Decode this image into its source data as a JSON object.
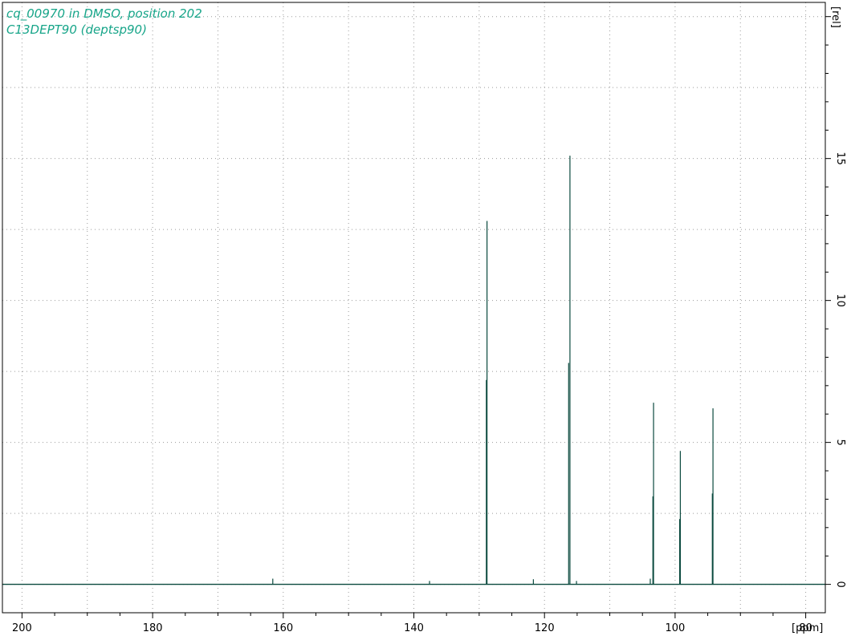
{
  "header": {
    "line1": "cq_00970 in DMSO, position 202",
    "line2": "C13DEPT90 (deptsp90)"
  },
  "chart_data": {
    "type": "line",
    "title": "",
    "xlabel": "[ppm]",
    "ylabel": "[rel]",
    "x_reversed": true,
    "xlim": [
      203.0,
      77.0
    ],
    "ylim": [
      -1.0,
      20.5
    ],
    "x_ticks": [
      200,
      180,
      160,
      140,
      120,
      100,
      80
    ],
    "x_tick_labels": [
      "200",
      "180",
      "160",
      "140",
      "120",
      "100",
      "80"
    ],
    "y_ticks": [
      0,
      5,
      10,
      15
    ],
    "y_tick_labels": [
      "0",
      "5",
      "10",
      "15"
    ],
    "grid": true,
    "colors": {
      "trace": "#0b4a3f",
      "header_text": "#17a589",
      "grid": "#9a9a9a"
    },
    "series": [
      {
        "peaks": [
          {
            "ppm": 128.8,
            "intensity": 12.8
          },
          {
            "ppm": 128.9,
            "intensity": 7.2
          },
          {
            "ppm": 116.1,
            "intensity": 15.1
          },
          {
            "ppm": 116.3,
            "intensity": 7.8
          },
          {
            "ppm": 103.3,
            "intensity": 6.4
          },
          {
            "ppm": 103.4,
            "intensity": 3.1
          },
          {
            "ppm": 99.2,
            "intensity": 4.7
          },
          {
            "ppm": 99.3,
            "intensity": 2.3
          },
          {
            "ppm": 94.2,
            "intensity": 6.2
          },
          {
            "ppm": 94.3,
            "intensity": 3.2
          },
          {
            "ppm": 161.6,
            "intensity": 0.2
          },
          {
            "ppm": 137.6,
            "intensity": 0.12
          },
          {
            "ppm": 121.7,
            "intensity": 0.18
          },
          {
            "ppm": 115.1,
            "intensity": 0.12
          },
          {
            "ppm": 103.8,
            "intensity": 0.2
          }
        ]
      }
    ]
  }
}
